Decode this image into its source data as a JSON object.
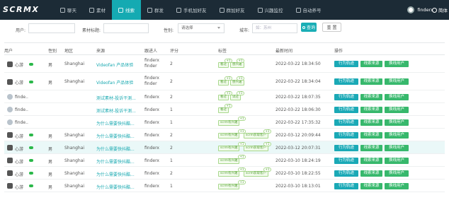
{
  "app": {
    "logo_text": "SCRMX"
  },
  "nav": [
    {
      "label": "聊天",
      "icon": "chat-icon"
    },
    {
      "label": "素材",
      "icon": "document-icon"
    },
    {
      "label": "线索",
      "icon": "link-icon"
    },
    {
      "label": "群发",
      "icon": "send-icon"
    },
    {
      "label": "手机加好友",
      "icon": "add-friend-icon"
    },
    {
      "label": "群加好友",
      "icon": "group-add-icon"
    },
    {
      "label": "兴趣监控",
      "icon": "monitor-icon"
    },
    {
      "label": "自动养号",
      "icon": "robot-icon"
    }
  ],
  "nav_active": "线索",
  "user": {
    "name": "finderx"
  },
  "language": {
    "label": "简体"
  },
  "filters": {
    "user_label": "用户:",
    "material_label": "素材标题:",
    "gender_label": "性别:",
    "gender_value": "请选择",
    "city_label": "城市:",
    "city_placeholder": "如：苏州",
    "search_button": "查询",
    "reset_button": "重 置"
  },
  "table": {
    "columns": [
      "用户",
      "性别",
      "地区",
      "来源",
      "跟进人",
      "评分",
      "标签",
      "最新时间",
      "操作"
    ],
    "actions": {
      "track": "行为轨迹",
      "source": "线索来源",
      "change": "换线用户"
    },
    "rows": [
      {
        "user": "心游",
        "avatar": "dark",
        "wechat": true,
        "gender": "男",
        "region": "Shanghai",
        "source": "Videofan 产品体验",
        "follower": "finderx finder",
        "score": "2",
        "tags": [
          {
            "label": "看过",
            "plus": "+1"
          },
          {
            "label": "感兴趣",
            "plus": "+1"
          }
        ],
        "time": "2022-03-22 18:34:50",
        "highlight": false
      },
      {
        "user": "心游",
        "avatar": "dark",
        "wechat": true,
        "gender": "男",
        "region": "Shanghai",
        "source": "Videofan 产品体验",
        "follower": "finderx finder",
        "score": "2",
        "tags": [
          {
            "label": "看过",
            "plus": "+1"
          },
          {
            "label": "感兴趣",
            "plus": "+1"
          }
        ],
        "time": "2022-03-22 18:34:04",
        "highlight": false
      },
      {
        "user": "finde..",
        "avatar": "person",
        "wechat": false,
        "gender": "",
        "region": "",
        "source": "测试素材-投诉干测...",
        "follower": "finderx",
        "score": "2",
        "tags": [
          {
            "label": "看过",
            "plus": "+1"
          },
          {
            "label": "试过",
            "plus": "+1"
          }
        ],
        "time": "2022-03-22 18:07:35",
        "highlight": false
      },
      {
        "user": "finde..",
        "avatar": "person",
        "wechat": false,
        "gender": "",
        "region": "",
        "source": "测试素材-投诉干测...",
        "follower": "finderx",
        "score": "1",
        "tags": [
          {
            "label": "看过",
            "plus": "+1"
          }
        ],
        "time": "2022-03-22 18:06:30",
        "highlight": false
      },
      {
        "user": "finde..",
        "avatar": "person",
        "wechat": false,
        "gender": "",
        "region": "",
        "source": "为什么需要快抖酷...",
        "follower": "finderx",
        "score": "1",
        "tags": [
          {
            "label": "scrm有兴趣",
            "plus": "+1"
          }
        ],
        "time": "2022-03-22 17:35:32",
        "highlight": false
      },
      {
        "user": "心游",
        "avatar": "dark",
        "wechat": true,
        "gender": "男",
        "region": "Shanghai",
        "source": "为什么需要快抖酷...",
        "follower": "finderx",
        "score": "2",
        "tags": [
          {
            "label": "scrm有兴趣",
            "plus": "+1"
          },
          {
            "label": "scrm获取客户",
            "plus": "+1"
          }
        ],
        "time": "2022-03-12 20:09:44",
        "highlight": false
      },
      {
        "user": "心游",
        "avatar": "dark",
        "wechat": true,
        "gender": "男",
        "region": "Shanghai",
        "source": "为什么需要快抖酷...",
        "follower": "finderx",
        "score": "2",
        "tags": [
          {
            "label": "scrm有兴趣",
            "plus": "+1"
          },
          {
            "label": "scrm获取客户",
            "plus": "+1"
          }
        ],
        "time": "2022-03-12 20:07:31",
        "highlight": true
      },
      {
        "user": "心游",
        "avatar": "dark",
        "wechat": true,
        "gender": "男",
        "region": "Shanghai",
        "source": "为什么需要快抖酷...",
        "follower": "finderx",
        "score": "1",
        "tags": [
          {
            "label": "scrm有兴趣",
            "plus": "+1"
          }
        ],
        "time": "2022-03-10 18:24:19",
        "highlight": false
      },
      {
        "user": "心游",
        "avatar": "dark",
        "wechat": true,
        "gender": "男",
        "region": "Shanghai",
        "source": "为什么需要快抖酷...",
        "follower": "finderx",
        "score": "2",
        "tags": [
          {
            "label": "scrm有兴趣",
            "plus": "+1"
          },
          {
            "label": "scrm获取客户",
            "plus": "+1"
          }
        ],
        "time": "2022-03-10 18:22:55",
        "highlight": false
      },
      {
        "user": "心游",
        "avatar": "dark",
        "wechat": true,
        "gender": "男",
        "region": "Shanghai",
        "source": "为什么需要快抖酷...",
        "follower": "finderx",
        "score": "1",
        "tags": [
          {
            "label": "scrm有兴趣",
            "plus": "+1"
          }
        ],
        "time": "2022-03-10 18:13:01",
        "highlight": false
      }
    ]
  }
}
